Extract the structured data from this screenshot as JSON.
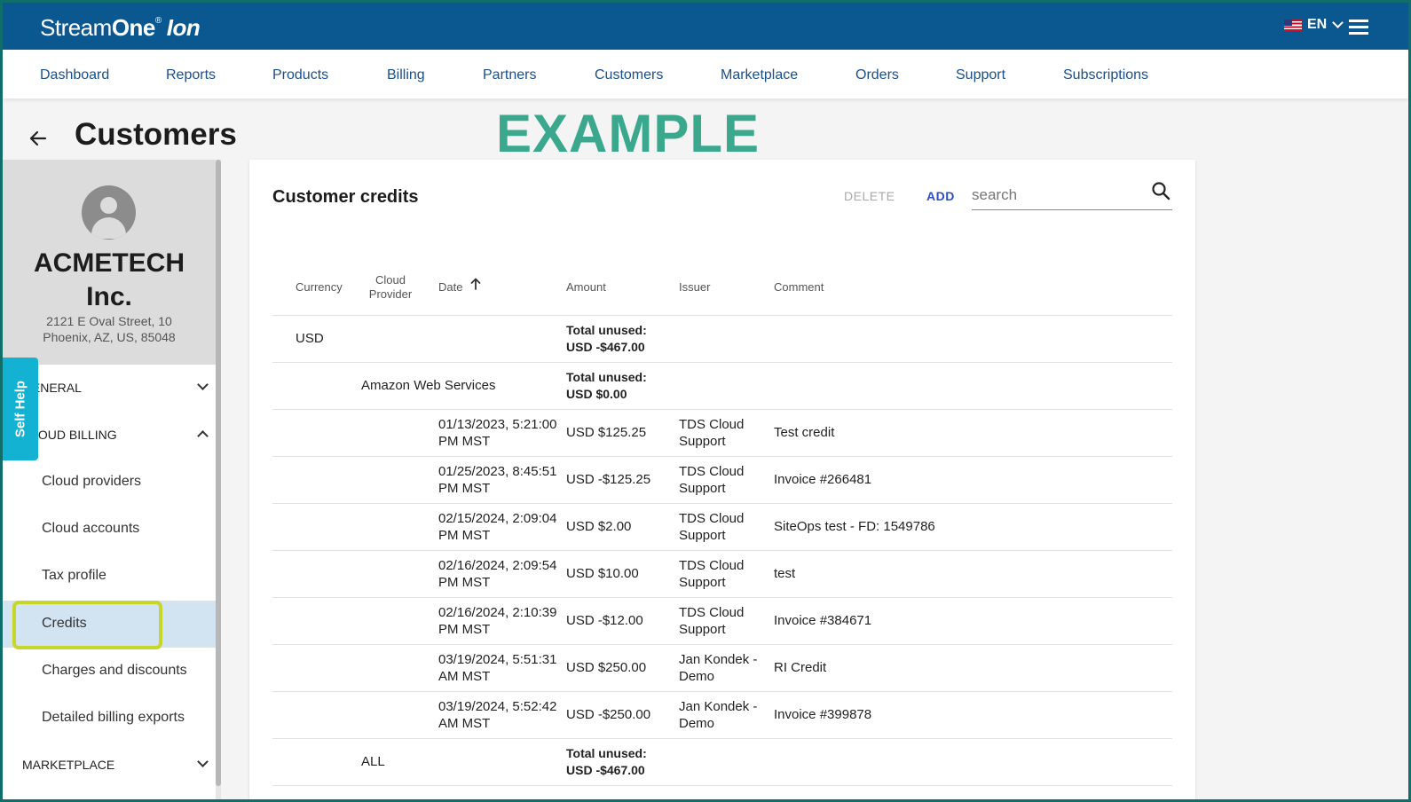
{
  "app": {
    "logo_main": "Stream",
    "logo_one": "One",
    "logo_reg": "®",
    "logo_ion": "Ion",
    "language": "EN"
  },
  "nav": [
    {
      "label": "Dashboard"
    },
    {
      "label": "Reports"
    },
    {
      "label": "Products"
    },
    {
      "label": "Billing"
    },
    {
      "label": "Partners"
    },
    {
      "label": "Customers"
    },
    {
      "label": "Marketplace"
    },
    {
      "label": "Orders"
    },
    {
      "label": "Support"
    },
    {
      "label": "Subscriptions"
    }
  ],
  "page": {
    "title": "Customers",
    "watermark": "EXAMPLE"
  },
  "customer": {
    "name_line1": "ACMETECH",
    "name_line2": "Inc.",
    "address_line1": "2121 E Oval Street, 10",
    "address_line2": "Phoenix, AZ, US, 85048"
  },
  "sidebar": {
    "self_help": "Self Help",
    "sections": {
      "general": "GENERAL",
      "cloud_billing": "CLOUD BILLING",
      "marketplace": "MARKETPLACE"
    },
    "items": [
      {
        "label": "Cloud providers"
      },
      {
        "label": "Cloud accounts"
      },
      {
        "label": "Tax profile"
      },
      {
        "label": "Credits"
      },
      {
        "label": "Charges and discounts"
      },
      {
        "label": "Detailed billing exports"
      }
    ]
  },
  "credits": {
    "title": "Customer credits",
    "delete_label": "DELETE",
    "add_label": "ADD",
    "search_placeholder": "search",
    "columns": {
      "currency": "Currency",
      "cloud_provider_1": "Cloud",
      "cloud_provider_2": "Provider",
      "date": "Date",
      "amount": "Amount",
      "issuer": "Issuer",
      "comment": "Comment"
    },
    "group_usd": {
      "currency": "USD",
      "total_1": "Total unused:",
      "total_2": "USD -$467.00"
    },
    "group_aws": {
      "provider": "Amazon Web Services",
      "total_1": "Total unused:",
      "total_2": "USD $0.00"
    },
    "rows": [
      {
        "date1": "01/13/2023, 5:21:00",
        "date2": "PM MST",
        "amount": "USD $125.25",
        "issuer1": "TDS Cloud",
        "issuer2": "Support",
        "comment": "Test credit"
      },
      {
        "date1": "01/25/2023, 8:45:51",
        "date2": "PM MST",
        "amount": "USD -$125.25",
        "issuer1": "TDS Cloud",
        "issuer2": "Support",
        "comment": "Invoice #266481"
      },
      {
        "date1": "02/15/2024, 2:09:04",
        "date2": "PM MST",
        "amount": "USD $2.00",
        "issuer1": "TDS Cloud",
        "issuer2": "Support",
        "comment": "SiteOps test - FD: 1549786"
      },
      {
        "date1": "02/16/2024, 2:09:54",
        "date2": "PM MST",
        "amount": "USD $10.00",
        "issuer1": "TDS Cloud",
        "issuer2": "Support",
        "comment": "test"
      },
      {
        "date1": "02/16/2024, 2:10:39",
        "date2": "PM MST",
        "amount": "USD -$12.00",
        "issuer1": "TDS Cloud",
        "issuer2": "Support",
        "comment": "Invoice #384671"
      },
      {
        "date1": "03/19/2024, 5:51:31",
        "date2": "AM MST",
        "amount": "USD $250.00",
        "issuer1": "Jan Kondek -",
        "issuer2": "Demo",
        "comment": "RI Credit"
      },
      {
        "date1": "03/19/2024, 5:52:42",
        "date2": "AM MST",
        "amount": "USD -$250.00",
        "issuer1": "Jan Kondek -",
        "issuer2": "Demo",
        "comment": "Invoice #399878"
      }
    ],
    "group_all": {
      "provider": "ALL",
      "total_1": "Total unused:",
      "total_2": "USD -$467.00"
    }
  }
}
